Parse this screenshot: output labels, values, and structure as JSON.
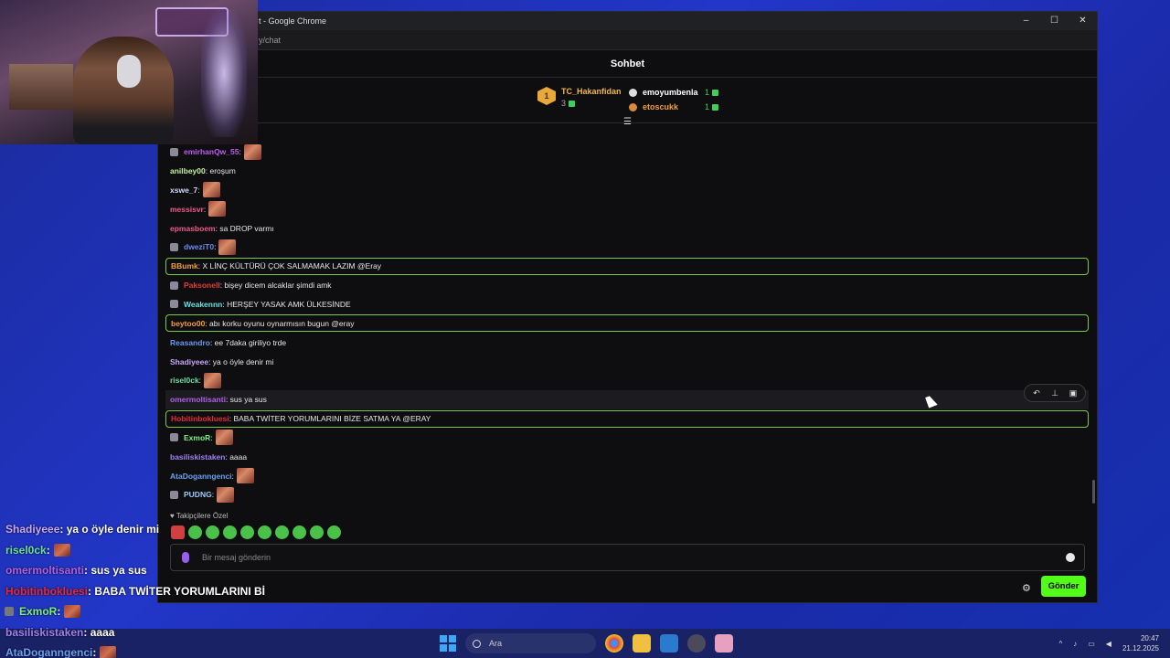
{
  "window": {
    "title": "t - Google Chrome",
    "url": "y/chat",
    "controls": [
      "–",
      "☐",
      "✕"
    ]
  },
  "chat": {
    "title": "Sohbet",
    "leaderboard": {
      "first": {
        "rank": "1",
        "name": "TC_Hakanfidan",
        "count": "3"
      },
      "others": [
        {
          "name": "emoyumbenla",
          "count": "1",
          "color": "#ffffff"
        },
        {
          "name": "etoscukk",
          "count": "1",
          "color": "#f0a03a"
        }
      ]
    },
    "messages": [
      {
        "user": "emirhanQw_55",
        "text": "",
        "color": "#c05cf0",
        "badge": true,
        "emote": true,
        "hl": false
      },
      {
        "user": "anilbey00",
        "text": ": eroşum",
        "color": "#c8f0a0",
        "badge": false,
        "emote": false,
        "hl": false
      },
      {
        "user": "xswe_7",
        "text": "",
        "color": "#d0d8ff",
        "badge": false,
        "emote": true,
        "hl": false
      },
      {
        "user": "messisvr",
        "text": "",
        "color": "#f05a8a",
        "badge": false,
        "emote": true,
        "hl": false
      },
      {
        "user": "epmasboem",
        "text": ": sa DROP varmı",
        "color": "#f05a8a",
        "badge": false,
        "emote": false,
        "hl": false
      },
      {
        "user": "dweziT0",
        "text": "",
        "color": "#6a8af0",
        "badge": true,
        "emote": true,
        "hl": false
      },
      {
        "user": "BBumk",
        "text": ": X LİNÇ KÜLTÜRÜ ÇOK SALMAMAK LAZIM @Eray",
        "color": "#f0a040",
        "badge": false,
        "emote": false,
        "hl": true
      },
      {
        "user": "Paksonell",
        "text": ": bişey dicem alcaklar şimdi amk",
        "color": "#e83a3a",
        "badge": true,
        "emote": false,
        "hl": false
      },
      {
        "user": "Weakennn",
        "text": ": HERŞEY YASAK AMK ÜLKESİNDE",
        "color": "#6ae0e0",
        "badge": true,
        "emote": false,
        "hl": false
      },
      {
        "user": "beytoo00",
        "text": ": abı korku oyunu oynarmısın bugun @eray",
        "color": "#f0a040",
        "badge": false,
        "emote": false,
        "hl": true
      },
      {
        "user": "Reasandro",
        "text": ": ee 7daka giriliyo trde",
        "color": "#6a9af0",
        "badge": false,
        "emote": false,
        "hl": false
      },
      {
        "user": "Shadiyeee",
        "text": ": ya o öyle denir mi",
        "color": "#c8a8f8",
        "badge": false,
        "emote": false,
        "hl": false
      },
      {
        "user": "risel0ck",
        "text": "",
        "color": "#6ae0a0",
        "badge": false,
        "emote": true,
        "hl": false
      },
      {
        "user": "omermoltisanti",
        "text": ": sus ya sus",
        "color": "#b060e8",
        "badge": false,
        "emote": false,
        "hl": false,
        "hover": true
      },
      {
        "user": "Hobitinbokluesi",
        "text": ": BABA TWİTER YORUMLARINI BİZE SATMA YA @ERAY",
        "color": "#e8283a",
        "badge": false,
        "emote": false,
        "hl": true
      },
      {
        "user": "ExmoR",
        "text": "",
        "color": "#7ef07e",
        "badge": true,
        "emote": true,
        "hl": false
      },
      {
        "user": "basiliskistaken",
        "text": ": aaaa",
        "color": "#a080f0",
        "badge": false,
        "emote": false,
        "hl": false
      },
      {
        "user": "AtaDoganngenci",
        "text": "",
        "color": "#6aa0f0",
        "badge": false,
        "emote": true,
        "hl": false
      },
      {
        "user": "PUDNG",
        "text": "",
        "color": "#a0c8f8",
        "badge": true,
        "emote": true,
        "hl": false
      }
    ],
    "followers_label": "Takipçilere Özel",
    "input_placeholder": "Bir mesaj gönderin",
    "send_label": "Gönder",
    "colors": {
      "accent": "#53fc18",
      "highlight_border": "#7ec84a",
      "background": "#0e0e10"
    }
  },
  "overlay": [
    {
      "user": "Shadiyeee",
      "text": ": ya o öyle denir mi",
      "color": "#c8a8f8",
      "emote": false,
      "badge": false
    },
    {
      "user": "risel0ck",
      "text": " :",
      "color": "#6ae0a0",
      "emote": true,
      "badge": false
    },
    {
      "user": "omermoltisanti",
      "text": " : sus ya sus",
      "color": "#b060e8",
      "emote": false,
      "badge": false
    },
    {
      "user": "Hobitinbokluesi",
      "text": " : BABA TWİTER YORUMLARINI Bİ",
      "color": "#e8283a",
      "emote": false,
      "badge": false
    },
    {
      "user": "ExmoR",
      "text": " :",
      "color": "#7ef07e",
      "emote": true,
      "badge": true
    },
    {
      "user": "basiliskistaken",
      "text": " : aaaa",
      "color": "#a080f0",
      "emote": false,
      "badge": false
    },
    {
      "user": "AtaDoganngenci",
      "text": " :",
      "color": "#6aa0f0",
      "emote": true,
      "badge": false
    }
  ],
  "taskbar": {
    "search_label": "Ara",
    "time": "20:47",
    "date": "21.12.2025"
  }
}
